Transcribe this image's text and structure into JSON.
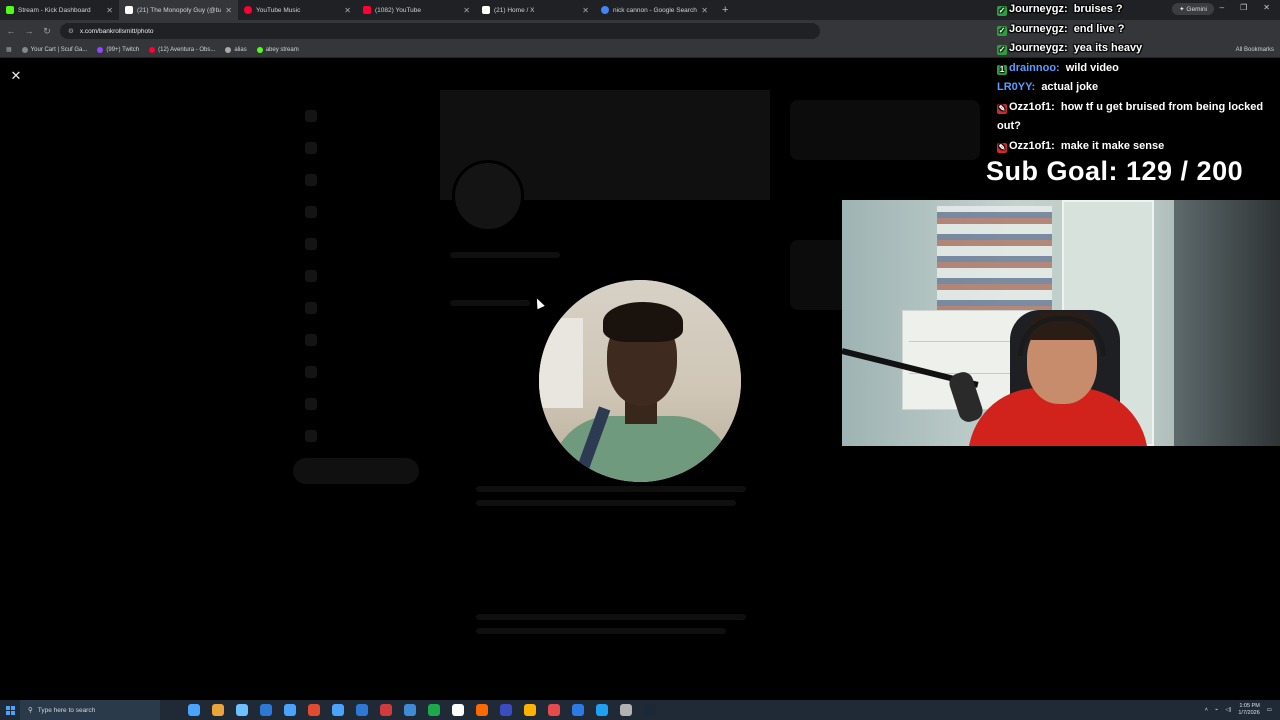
{
  "browser": {
    "tabs": [
      {
        "label": "Stream - Kick Dashboard",
        "color": "#53fc18",
        "active": false
      },
      {
        "label": "(21) The Monopoly Guy (@ban",
        "color": "#ffffff",
        "active": true
      },
      {
        "label": "YouTube Music",
        "color": "#ff0033",
        "active": false
      },
      {
        "label": "(1082) YouTube",
        "color": "#ff0033",
        "active": false
      },
      {
        "label": "(21) Home / X",
        "color": "#ffffff",
        "active": false
      },
      {
        "label": "nick cannon - Google Search",
        "color": "#4285f4",
        "active": false
      }
    ],
    "new_tab": "+",
    "url": "x.com/bankrollsmitt/photo",
    "gemini": "✦ Gemini",
    "bookmarks": [
      {
        "label": "Your Cart | Scuf Ga...",
        "color": "#888888"
      },
      {
        "label": "(99+) Twitch",
        "color": "#9146ff"
      },
      {
        "label": "(12) Aventura - Obs...",
        "color": "#ff0033"
      },
      {
        "label": "alias",
        "color": "#aaaaaa"
      },
      {
        "label": "abey stream",
        "color": "#53fc18"
      }
    ],
    "all_bookmarks": "All Bookmarks"
  },
  "viewer": {
    "close_icon": "✕"
  },
  "chat": {
    "messages": [
      {
        "user": "Journeygz:",
        "text": "bruises ?",
        "user_color": "#ffffff",
        "badge": "check-icon",
        "badge_color": "#2e9e3e"
      },
      {
        "user": "Journeygz:",
        "text": "end live ?",
        "user_color": "#ffffff",
        "badge": "check-icon",
        "badge_color": "#2e9e3e"
      },
      {
        "user": "Journeygz:",
        "text": "yea its heavy",
        "user_color": "#ffffff",
        "badge": "check-icon",
        "badge_color": "#2e9e3e"
      },
      {
        "user": "drainnoo:",
        "text": "wild video",
        "user_color": "#5b9cff",
        "badge": "sub-icon",
        "badge_color": "#2e9e3e"
      },
      {
        "user": "LR0YY:",
        "text": "actual joke",
        "user_color": "#5b9cff",
        "badge": "",
        "badge_color": ""
      },
      {
        "user": "Ozz1of1:",
        "text": "how tf u get bruised from being locked out?",
        "user_color": "#ffffff",
        "badge": "pencil-icon",
        "badge_color": "#d02b2b"
      },
      {
        "user": "Ozz1of1:",
        "text": "make it make sense",
        "user_color": "#ffffff",
        "badge": "pencil-icon",
        "badge_color": "#d02b2b"
      }
    ],
    "sub_goal": "Sub Goal:  129 / 200"
  },
  "taskbar": {
    "search_placeholder": "Type here to search",
    "time": "1:05 PM",
    "date": "1/7/2026",
    "apps": [
      "#4aa3ff",
      "#e9a53a",
      "#6ec1ff",
      "#2b78d6",
      "#4aa3ff",
      "#e34b2f",
      "#4aa3ff",
      "#2b78d6",
      "#d23b3b",
      "#3e8bd8",
      "#1ba94c",
      "#ffffff",
      "#ff6a00",
      "#3b4cc0",
      "#ffb300",
      "#e64a4a",
      "#2c7be5",
      "#1ea1f2",
      "#b2b2b2",
      "#1b2838"
    ]
  }
}
